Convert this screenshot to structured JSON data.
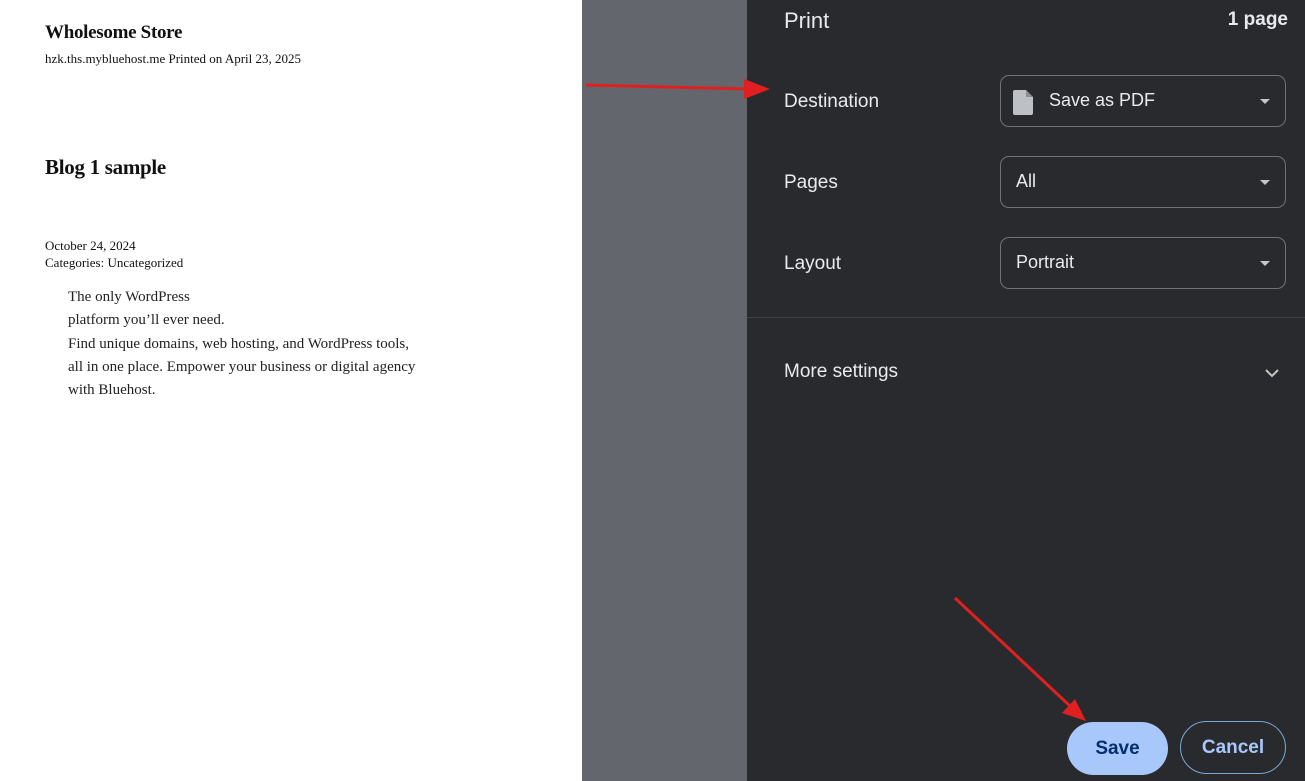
{
  "preview": {
    "site_title": "Wholesome Store",
    "site_meta": "hzk.ths.mybluehost.me Printed on April 23, 2025",
    "post_title": "Blog 1 sample",
    "post_date": "October 24, 2024",
    "post_categories": "Categories: Uncategorized",
    "body_lines": [
      "The only WordPress",
      "platform you’ll ever need.",
      "Find unique domains, web hosting, and WordPress tools,",
      "all in one place. Empower your business or digital agency",
      "with Bluehost."
    ]
  },
  "dialog": {
    "title": "Print",
    "page_count": "1 page",
    "destination": {
      "label": "Destination",
      "value": "Save as PDF",
      "icon": "document-icon"
    },
    "pages": {
      "label": "Pages",
      "value": "All"
    },
    "layout": {
      "label": "Layout",
      "value": "Portrait"
    },
    "more_settings": {
      "label": "More settings",
      "icon": "chevron-down-icon"
    },
    "save_label": "Save",
    "cancel_label": "Cancel"
  },
  "colors": {
    "panel_bg": "#292a2d",
    "gutter_bg": "#63666c",
    "save_bg": "#a8c7fa",
    "annotation": "#e02020"
  }
}
